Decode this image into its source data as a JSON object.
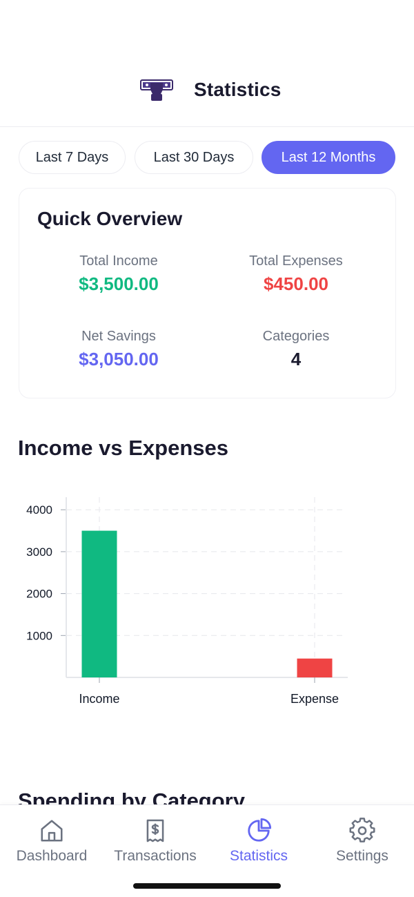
{
  "header": {
    "title": "Statistics",
    "logo_icon": "money-fist-icon"
  },
  "periods": [
    {
      "label": "Last 7 Days",
      "active": false
    },
    {
      "label": "Last 30 Days",
      "active": false
    },
    {
      "label": "Last 12 Months",
      "active": true
    }
  ],
  "overview": {
    "title": "Quick Overview",
    "total_income": {
      "label": "Total Income",
      "value": "$3,500.00",
      "color": "#10b981"
    },
    "total_expenses": {
      "label": "Total Expenses",
      "value": "$450.00",
      "color": "#ef4444"
    },
    "net_savings": {
      "label": "Net Savings",
      "value": "$3,050.00",
      "color": "#6366f1"
    },
    "categories": {
      "label": "Categories",
      "value": "4",
      "color": "#1a1a2e"
    }
  },
  "income_vs_expenses": {
    "title": "Income vs Expenses"
  },
  "chart_data": {
    "type": "bar",
    "categories": [
      "Income",
      "Expense"
    ],
    "values": [
      3500,
      450
    ],
    "colors": [
      "#10b981",
      "#ef4444"
    ],
    "ylim": [
      0,
      4300
    ],
    "yticks": [
      1000,
      2000,
      3000,
      4000
    ],
    "grid": true,
    "xlabel": "",
    "ylabel": ""
  },
  "spending_by_category": {
    "title": "Spending by Category"
  },
  "tabs": [
    {
      "label": "Dashboard",
      "icon": "home-icon",
      "active": false
    },
    {
      "label": "Transactions",
      "icon": "receipt-icon",
      "active": false
    },
    {
      "label": "Statistics",
      "icon": "pie-chart-icon",
      "active": true
    },
    {
      "label": "Settings",
      "icon": "gear-icon",
      "active": false
    }
  ],
  "colors": {
    "accent": "#6366f1",
    "income": "#10b981",
    "expense": "#ef4444"
  }
}
